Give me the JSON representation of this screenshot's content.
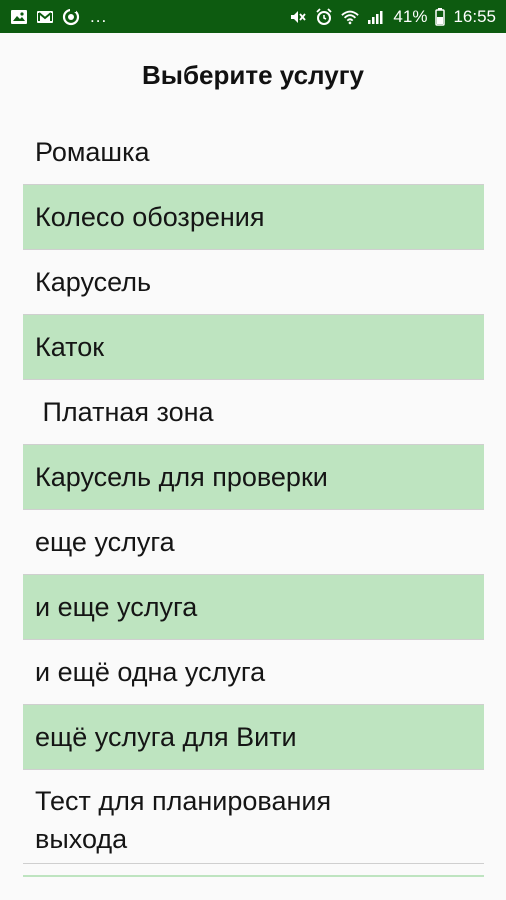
{
  "status_bar": {
    "left_icons": [
      "image-icon",
      "mail-icon",
      "sync-icon"
    ],
    "more": "...",
    "right_icons": [
      "mute-icon",
      "alarm-icon",
      "wifi-icon",
      "signal-icon"
    ],
    "battery": "41%",
    "time": "16:55"
  },
  "screen": {
    "title": "Выберите услугу"
  },
  "services": [
    {
      "label": "Ромашка"
    },
    {
      "label": "Колесо обозрения"
    },
    {
      "label": "Карусель"
    },
    {
      "label": "Каток"
    },
    {
      "label": " Платная зона"
    },
    {
      "label": "Карусель для проверки"
    },
    {
      "label": "еще услуга"
    },
    {
      "label": "и еще услуга"
    },
    {
      "label": "и ещё одна услуга"
    },
    {
      "label": "ещё услуга для Вити"
    },
    {
      "label": "Тест для планирования выхода"
    }
  ],
  "colors": {
    "status_bar": "#0d5b10",
    "highlight_row": "#bee4c0",
    "background": "#fafafa"
  }
}
